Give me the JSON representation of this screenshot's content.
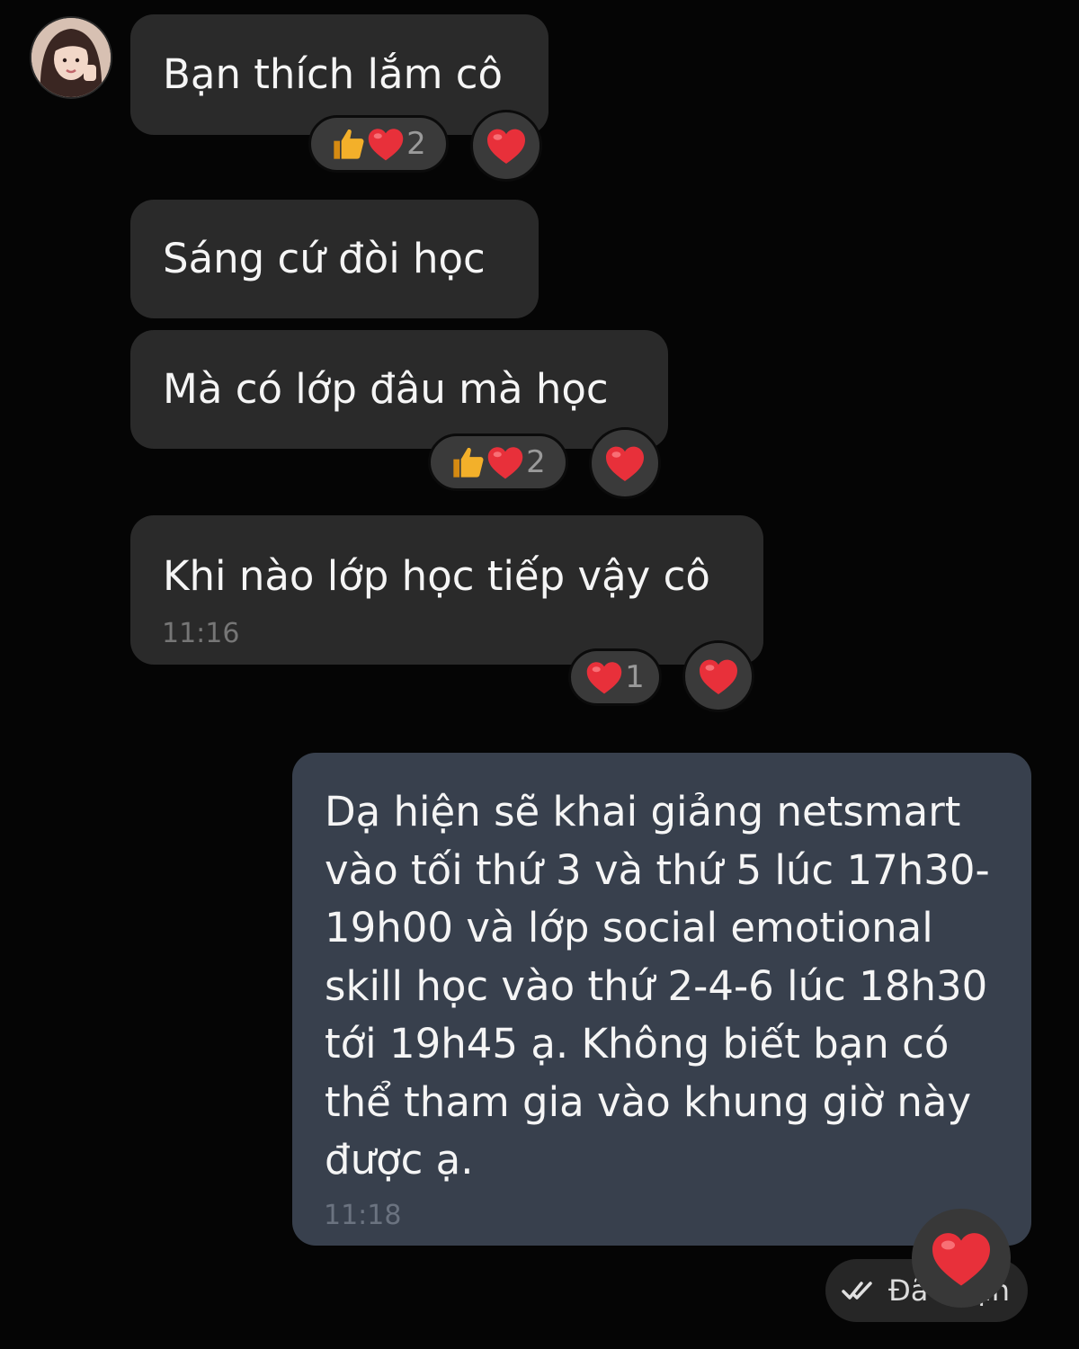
{
  "messages": [
    {
      "text": "Bạn thích lắm cô",
      "reaction_count": "2"
    },
    {
      "text": "Sáng cứ đòi học"
    },
    {
      "text": "Mà có lớp đâu mà học",
      "reaction_count": "2"
    },
    {
      "text": "Khi nào lớp học tiếp vậy cô",
      "time": "11:16",
      "reaction_count": "1"
    }
  ],
  "reply": {
    "text": "Dạ hiện sẽ khai giảng netsmart vào tối thứ 3 và thứ 5 lúc 17h30-19h00 và lớp social emotional skill học vào thứ 2-4-6 lúc 18h30 tới 19h45 ạ. Không biết bạn có thể tham gia vào khung giờ này được ạ.",
    "time": "11:18",
    "status": "Đã nhận"
  },
  "icons": [
    "avatar",
    "thumbs-up-icon",
    "heart-icon",
    "double-check-icon"
  ],
  "colors": {
    "background": "#050505",
    "incoming": "#2a2a2a",
    "outgoing": "#38404d",
    "heart": "#e8303a",
    "thumb": "#f3b02a"
  }
}
